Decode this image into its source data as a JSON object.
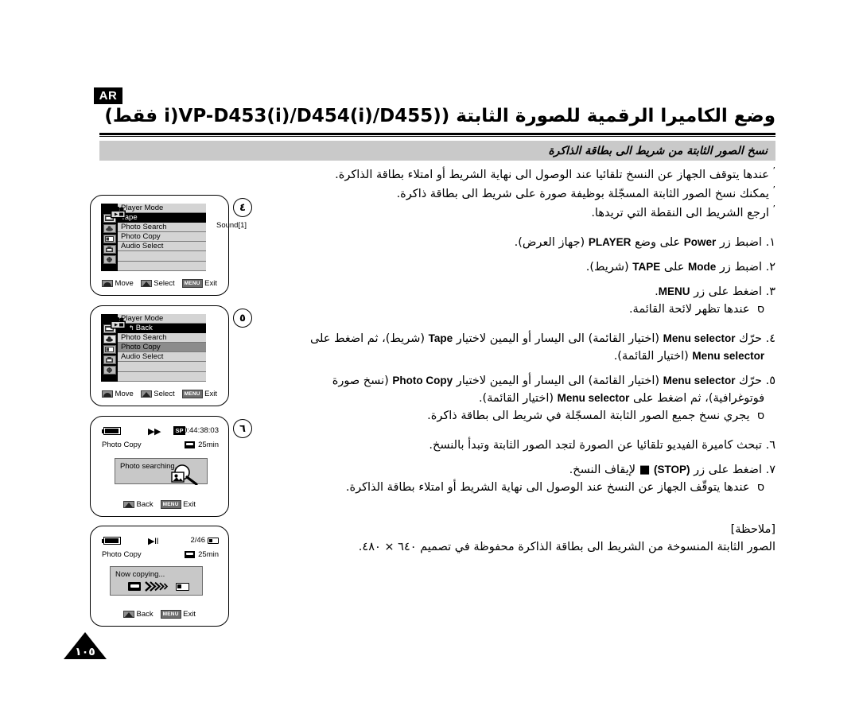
{
  "header": {
    "lang_badge": "AR",
    "title": "وضع الكاميرا الرقمية للصورة الثابتة ((VP-D453(i)/D454(i)/D455(i فقط)",
    "subtitle": "نسخ الصور الثابتة من شريط الى بطاقة الذاكرة"
  },
  "intro_bullets": [
    "عندها يتوقف الجهاز عن النسخ تلقائيا عند الوصول الى نهاية الشريط أو امتلاء بطاقة الذاكرة.",
    "يمكنك نسخ الصور الثابتة المسجّلة بوظيفة صورة على شريط الى بطاقة ذاكرة.",
    "ارجع الشريط الى النقطة التي تريدها."
  ],
  "steps": [
    {
      "num": "١.",
      "lines": [
        {
          "pre": "اضبط زر ",
          "lat": "Power",
          "mid": " على وضع ",
          "lat2": "PLAYER",
          "post": " (جهاز العرض)."
        }
      ],
      "notes": []
    },
    {
      "num": "٢.",
      "lines": [
        {
          "pre": "اضبط زر ",
          "lat": "Mode",
          "mid": " على ",
          "lat2": "TAPE",
          "post": " (شريط)."
        }
      ],
      "notes": []
    },
    {
      "num": "٣.",
      "lines": [
        {
          "pre": "اضغط على زر ",
          "lat": "MENU",
          "mid": "",
          "lat2": "",
          "post": "."
        }
      ],
      "notes": [
        "عندها تظهر لائحة القائمة."
      ]
    },
    {
      "num": "٤.",
      "lines": [
        {
          "pre": "حرّك ",
          "lat": "Menu selector",
          "mid": " (اختيار القائمة) الى اليسار أو اليمين لاختيار ",
          "lat2": "Tape",
          "post": " (شريط)، ثم اضغط على"
        },
        {
          "pre": "",
          "lat": "Menu selector",
          "mid": " (اختيار القائمة).",
          "lat2": "",
          "post": ""
        }
      ],
      "notes": []
    },
    {
      "num": "٥.",
      "lines": [
        {
          "pre": "حرّك ",
          "lat": "Menu selector",
          "mid": " (اختيار القائمة) الى اليسار أو اليمين لاختيار ",
          "lat2": "Photo Copy",
          "post": " (نسخ صورة"
        },
        {
          "pre": "فوتوغرافية)، ثم اضغط على ",
          "lat": "Menu selector",
          "mid": " (اختيار القائمة).",
          "lat2": "",
          "post": ""
        }
      ],
      "notes": [
        "يجري نسخ جميع الصور الثابتة المسجّلة في شريط الى بطاقة ذاكرة."
      ]
    },
    {
      "num": "٦.",
      "lines": [
        {
          "pre": "تبحث كاميرة الفيديو تلقائيا عن الصورة لتجد الصور الثابتة وتبدأ بالنسخ.",
          "lat": "",
          "mid": "",
          "lat2": "",
          "post": ""
        }
      ],
      "notes": []
    },
    {
      "num": "٧.",
      "lines": [
        {
          "pre": "اضغط على زر ",
          "lat": "(STOP)",
          "mid": " ■ لإيقاف النسخ.",
          "lat2": "",
          "post": ""
        }
      ],
      "notes": [
        "عندها يتوقّف الجهاز عن النسخ عند الوصول الى نهاية الشريط أو امتلاء بطاقة الذاكرة."
      ]
    }
  ],
  "note_block": {
    "heading": "[ملاحظة]",
    "body": "الصور الثابتة المنسوخة من الشريط الى بطاقة الذاكرة محفوظة في تصميم ٦٤٠ × ٤٨٠."
  },
  "screens": [
    {
      "id": "screen-4",
      "step_badge": "٤",
      "type": "menu",
      "title": "Player Mode",
      "side_value": "Sound[1]",
      "rows": [
        {
          "label": "Player Mode",
          "state": "header"
        },
        {
          "label": "Tape",
          "state": "highlight"
        },
        {
          "label": "Photo Search",
          "state": "normal"
        },
        {
          "label": "Photo Copy",
          "state": "normal"
        },
        {
          "label": "Audio Select",
          "state": "normal"
        },
        {
          "label": "",
          "state": "empty"
        },
        {
          "label": "",
          "state": "empty"
        }
      ],
      "hints": [
        {
          "key": "arc-up-icon",
          "label": "Move"
        },
        {
          "key": "arc-select-icon",
          "label": "Select"
        },
        {
          "key": "MENU",
          "label": "Exit"
        }
      ]
    },
    {
      "id": "screen-5",
      "step_badge": "٥",
      "type": "menu",
      "title": "Player Mode",
      "side_value": "",
      "rows": [
        {
          "label": "Player Mode",
          "state": "header"
        },
        {
          "label": "Back",
          "state": "highlight-back"
        },
        {
          "label": "Photo Search",
          "state": "normal"
        },
        {
          "label": "Photo Copy",
          "state": "gray"
        },
        {
          "label": "Audio Select",
          "state": "normal"
        },
        {
          "label": "",
          "state": "empty"
        },
        {
          "label": "",
          "state": "empty"
        }
      ],
      "hints": [
        {
          "key": "arc-up-icon",
          "label": "Move"
        },
        {
          "key": "arc-select-icon",
          "label": "Select"
        },
        {
          "key": "MENU",
          "label": "Exit"
        }
      ]
    },
    {
      "id": "screen-6",
      "step_badge": "٦",
      "type": "playback",
      "transport": "▶▶",
      "rec_mode": "SP",
      "timecode": "0:44:38:03",
      "mode_label": "Photo Copy",
      "tape_remaining": "25min",
      "dialog_text": "Photo searching...",
      "dialog_icon": "photo-search-icon",
      "hints": [
        {
          "key": "arc-select-icon",
          "label": "Back"
        },
        {
          "key": "MENU",
          "label": "Exit"
        }
      ]
    },
    {
      "id": "screen-7",
      "step_badge": "",
      "type": "playback",
      "transport": "▶II",
      "rec_mode": "",
      "counter": "2/46",
      "mode_label": "Photo Copy",
      "tape_remaining": "25min",
      "dialog_text": "Now copying...",
      "dialog_icon": "tape-to-card-icon",
      "hints": [
        {
          "key": "arc-select-icon",
          "label": "Back"
        },
        {
          "key": "MENU",
          "label": "Exit"
        }
      ]
    }
  ],
  "footer": {
    "page_number": "١٠٥"
  },
  "colors": {
    "subtitle_bar": "#c9c9c9",
    "menu_list_bg": "#d4d4d4",
    "menu_highlight": "#000000",
    "menu_gray": "#8c8c8c",
    "dialog_bg": "#c8c8c8"
  }
}
